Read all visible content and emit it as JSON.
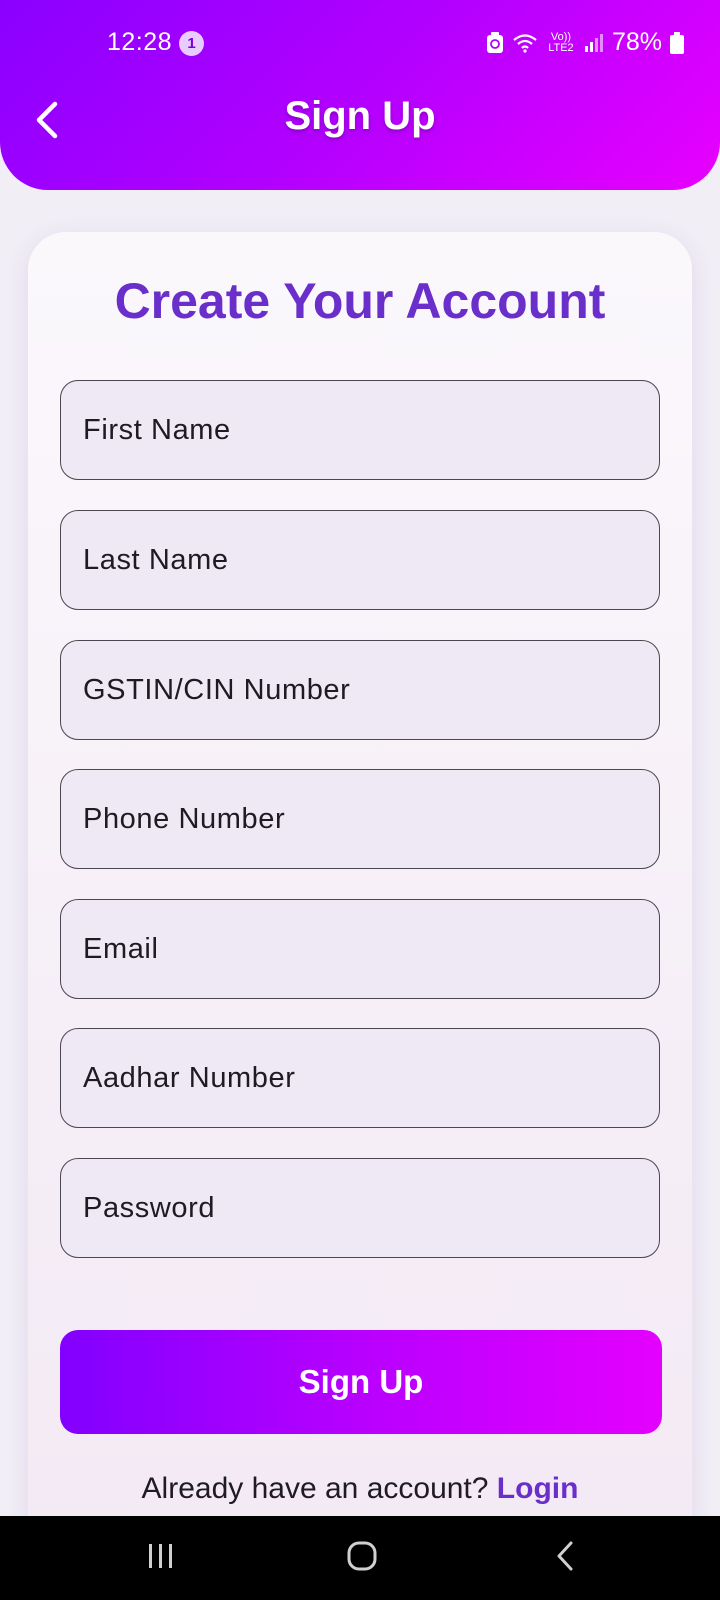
{
  "status_bar": {
    "time": "12:28",
    "notification_count": "1",
    "network_label": "Vo)) LTE2",
    "battery": "78%"
  },
  "header": {
    "title": "Sign Up",
    "back_icon": "chevron-left-icon"
  },
  "form": {
    "heading": "Create Your Account",
    "fields": [
      {
        "placeholder": "First Name"
      },
      {
        "placeholder": "Last Name"
      },
      {
        "placeholder": "GSTIN/CIN Number"
      },
      {
        "placeholder": "Phone Number"
      },
      {
        "placeholder": "Email"
      },
      {
        "placeholder": "Aadhar Number"
      },
      {
        "placeholder": "Password"
      }
    ],
    "submit_label": "Sign Up",
    "login_prompt": "Already have an account?",
    "login_link": "Login"
  },
  "colors": {
    "gradient_start": "#8200ff",
    "gradient_end": "#e400ff",
    "accent_text": "#6a2fcb"
  },
  "navbar": {
    "icons": [
      "recent-apps-icon",
      "home-icon",
      "back-icon"
    ]
  }
}
